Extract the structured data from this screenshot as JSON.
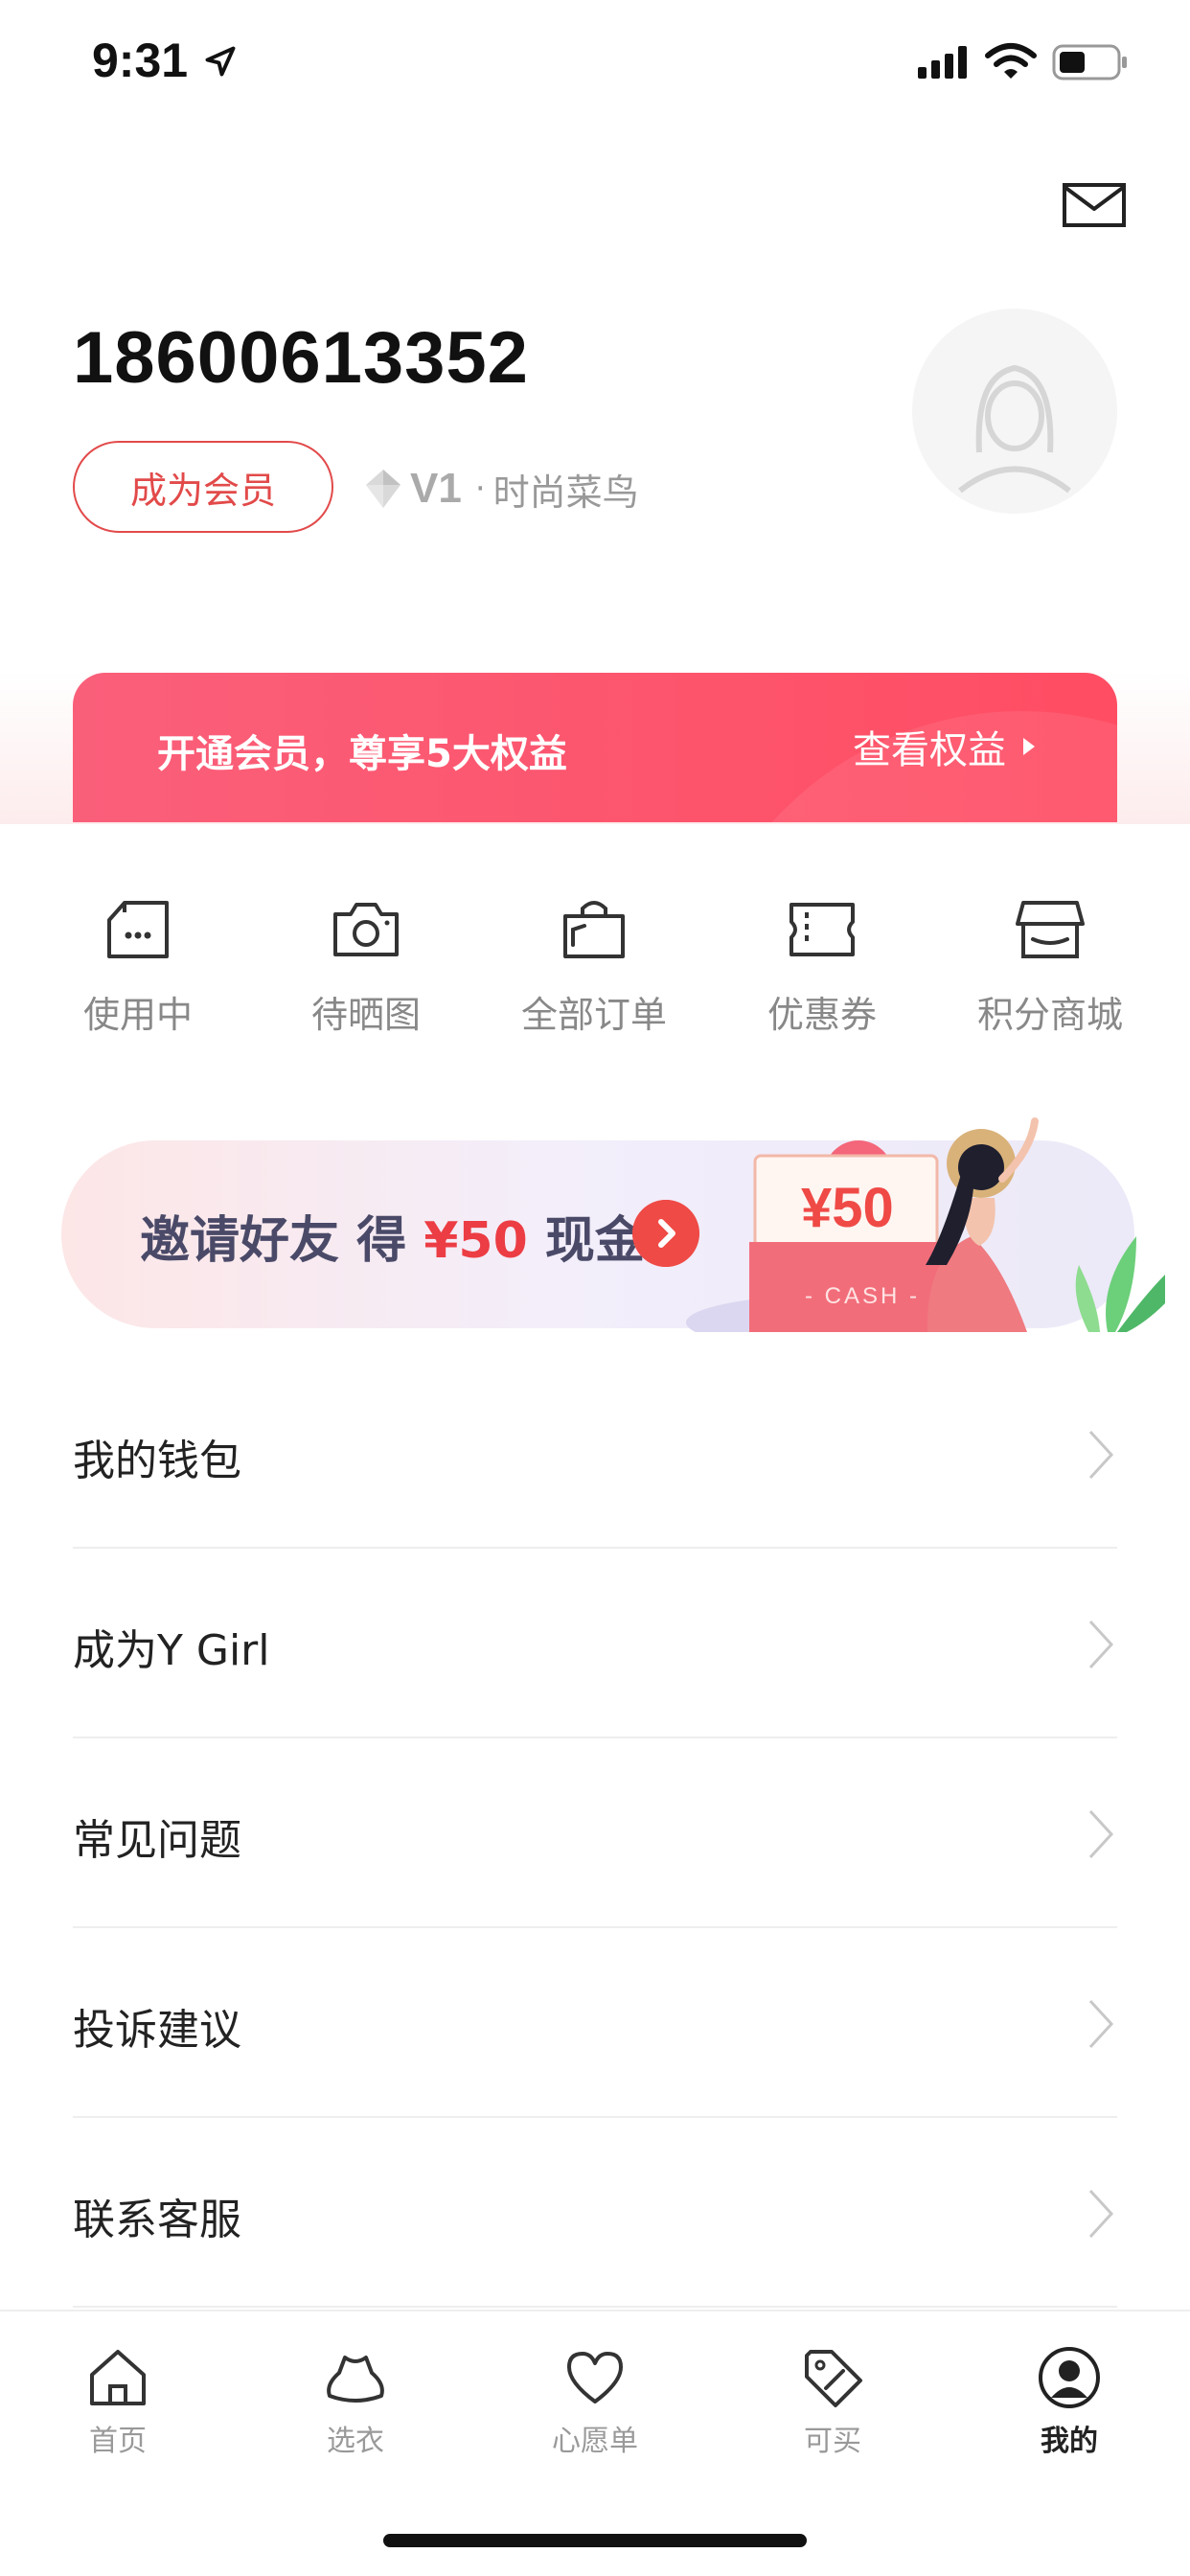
{
  "status_bar": {
    "time": "9:31"
  },
  "profile": {
    "phone": "18600613352",
    "become_member_label": "成为会员",
    "level_code": "V1",
    "level_dot": "·",
    "level_name": "时尚菜鸟"
  },
  "member_banner": {
    "text": "开通会员，尊享5大权益",
    "link_label": "查看权益"
  },
  "actions": [
    {
      "label": "使用中",
      "icon": "in-use-box-icon"
    },
    {
      "label": "待晒图",
      "icon": "camera-icon"
    },
    {
      "label": "全部订单",
      "icon": "shopping-bag-icon"
    },
    {
      "label": "优惠券",
      "icon": "coupon-icon"
    },
    {
      "label": "积分商城",
      "icon": "store-icon"
    }
  ],
  "invite": {
    "text_prefix": "邀请好友 得",
    "amount": "¥50",
    "text_suffix": "现金",
    "card_amount": "¥50",
    "card_label": "- CASH -"
  },
  "menu": [
    {
      "label": "我的钱包"
    },
    {
      "label": "成为Y Girl"
    },
    {
      "label": "常见问题"
    },
    {
      "label": "投诉建议"
    },
    {
      "label": "联系客服"
    }
  ],
  "tabs": [
    {
      "label": "首页",
      "icon": "home-icon"
    },
    {
      "label": "选衣",
      "icon": "clothes-icon"
    },
    {
      "label": "心愿单",
      "icon": "heart-icon"
    },
    {
      "label": "可买",
      "icon": "tag-icon"
    },
    {
      "label": "我的",
      "icon": "profile-icon",
      "active": true
    }
  ],
  "colors": {
    "accent_red": "#ef4a46",
    "member_banner": "#ff4d63",
    "text_primary": "#222222",
    "text_secondary": "#888888"
  }
}
